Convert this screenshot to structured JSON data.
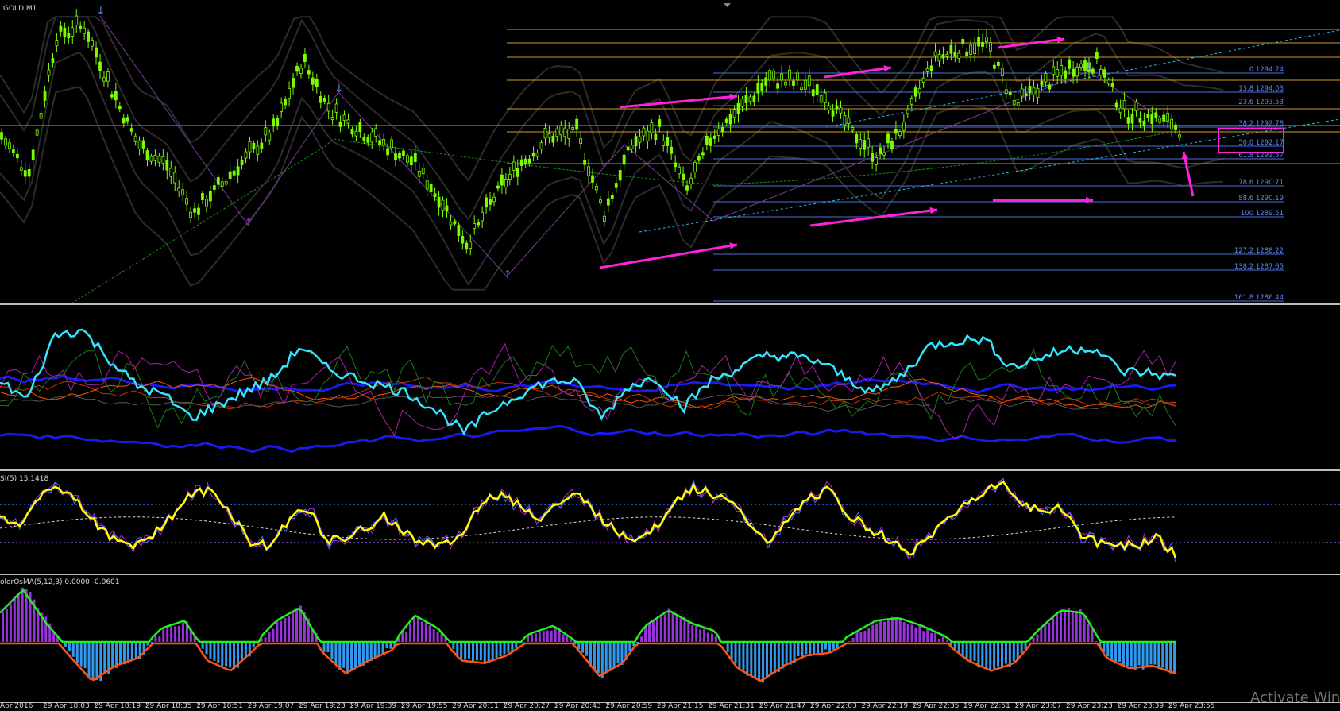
{
  "window": {
    "title": "GOLD,M1"
  },
  "panes": {
    "price": {
      "label": "GOLD,M1"
    },
    "rsi": {
      "label": "SI(5) 15.1418"
    },
    "osma": {
      "label": "olorOsMA(5,12,3) 0.0000 -0.0601"
    }
  },
  "watermark": "Activate Win",
  "colors": {
    "background": "#000000",
    "candle": "#7cfc00",
    "fib_blue": "#4f6fd8",
    "fib_orange": "#d49a2a",
    "arrows": "#ff22dd",
    "highlight_box": "#ff22dd",
    "rsi_main": "#ffff00",
    "osma_green": "#22ee22",
    "osma_orange": "#ff5511",
    "hist_purple": "#9933dd",
    "hist_blue": "#3399ee",
    "cyan_line": "#33e6ff"
  },
  "chart_data": [
    {
      "type": "candlestick",
      "symbol": "GOLD",
      "timeframe": "M1",
      "x_labels": [
        "Apr 2016",
        "29 Apr 18:03",
        "29 Apr 18:19",
        "29 Apr 18:35",
        "29 Apr 18:51",
        "29 Apr 19:07",
        "29 Apr 19:23",
        "29 Apr 19:39",
        "29 Apr 19:55",
        "29 Apr 20:11",
        "29 Apr 20:27",
        "29 Apr 20:43",
        "29 Apr 20:59",
        "29 Apr 21:15",
        "29 Apr 21:31",
        "29 Apr 21:47",
        "29 Apr 22:03",
        "29 Apr 22:19",
        "29 Apr 22:35",
        "29 Apr 22:51",
        "29 Apr 23:07",
        "29 Apr 23:23",
        "29 Apr 23:39",
        "29 Apr 23:55"
      ],
      "fib_levels": [
        {
          "pct": "0",
          "price": "1294.74"
        },
        {
          "pct": "13.8",
          "price": "1294.03"
        },
        {
          "pct": "23.6",
          "price": "1293.53"
        },
        {
          "pct": "38.2",
          "price": "1292.78"
        },
        {
          "pct": "50.0",
          "price": "1292.17"
        },
        {
          "pct": "61.8",
          "price": "1291.57"
        },
        {
          "pct": "78.6",
          "price": "1290.71"
        },
        {
          "pct": "88.6",
          "price": "1290.19"
        },
        {
          "pct": "100",
          "price": "1289.61"
        },
        {
          "pct": "127.2",
          "price": "1288.22"
        },
        {
          "pct": "138.2",
          "price": "1287.65"
        },
        {
          "pct": "161.8",
          "price": "1286.44"
        }
      ],
      "close_path": [
        0.55,
        0.42,
        0.9,
        0.94,
        0.72,
        0.52,
        0.45,
        0.28,
        0.38,
        0.48,
        0.58,
        0.82,
        0.64,
        0.58,
        0.52,
        0.46,
        0.33,
        0.17,
        0.34,
        0.46,
        0.55,
        0.56,
        0.28,
        0.52,
        0.58,
        0.36,
        0.56,
        0.65,
        0.75,
        0.74,
        0.7,
        0.57,
        0.47,
        0.6,
        0.82,
        0.86,
        0.87,
        0.66,
        0.73,
        0.79,
        0.81,
        0.63,
        0.62,
        0.58
      ]
    },
    {
      "type": "line",
      "name": "SI(5)",
      "last_value": 15.1418,
      "ylim": [
        0,
        100
      ],
      "values": [
        60,
        45,
        80,
        90,
        75,
        50,
        30,
        28,
        40,
        60,
        82,
        85,
        60,
        30,
        25,
        55,
        68,
        30,
        35,
        45,
        58,
        40,
        30,
        25,
        38,
        75,
        82,
        70,
        55,
        72,
        80,
        60,
        40,
        35,
        45,
        75,
        88,
        82,
        70,
        48,
        30,
        55,
        78,
        85,
        60,
        45,
        35,
        18,
        30,
        52,
        70,
        85,
        92,
        75,
        60,
        70,
        40,
        28,
        30,
        25,
        38,
        15
      ]
    },
    {
      "type": "histogram",
      "name": "olorOsMA(5,12,3)",
      "values": [
        0.0,
        "-0.0601"
      ],
      "bars": [
        0.5,
        0.95,
        0.3,
        -0.2,
        -0.7,
        -0.4,
        -0.25,
        0.2,
        0.35,
        -0.3,
        -0.5,
        -0.1,
        0.35,
        0.6,
        -0.15,
        -0.55,
        -0.3,
        -0.1,
        0.45,
        0.2,
        -0.3,
        -0.35,
        -0.2,
        0.1,
        0.25,
        -0.05,
        -0.6,
        -0.35,
        0.25,
        0.55,
        0.3,
        0.15,
        -0.45,
        -0.7,
        -0.4,
        -0.2,
        -0.15,
        0.1,
        0.35,
        0.4,
        0.25,
        0.05,
        -0.3,
        -0.5,
        -0.35,
        0.15,
        0.55,
        0.5,
        -0.25,
        -0.45,
        -0.4,
        -0.55
      ]
    }
  ]
}
